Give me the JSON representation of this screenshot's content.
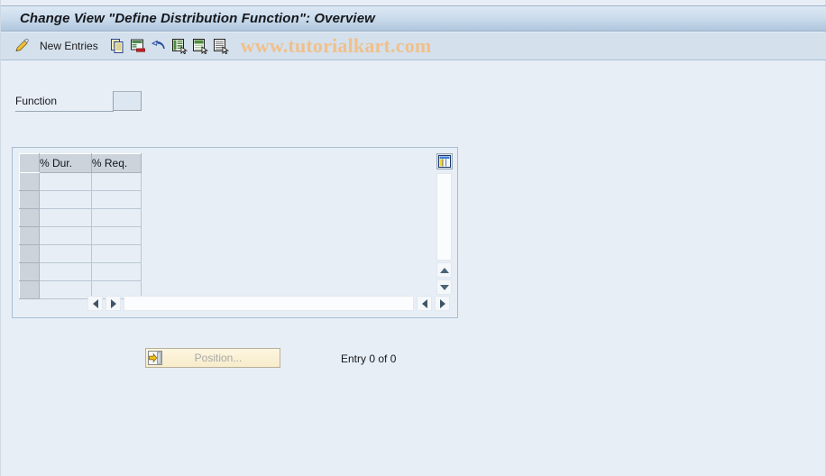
{
  "window": {
    "title": "Change View \"Define Distribution Function\": Overview"
  },
  "toolbar": {
    "display_change_icon": "pencil-display-change-icon",
    "new_entries_label": "New Entries",
    "buttons": [
      {
        "name": "copy-as-icon",
        "title": "Copy As..."
      },
      {
        "name": "delete-icon",
        "title": "Delete"
      },
      {
        "name": "undo-icon",
        "title": "Undo Change"
      },
      {
        "name": "select-all-icon",
        "title": "Select All"
      },
      {
        "name": "deselect-all-icon",
        "title": "Deselect All"
      },
      {
        "name": "select-block-icon",
        "title": "Select Block"
      }
    ],
    "watermark": "www.tutorialkart.com"
  },
  "form": {
    "function_label": "Function",
    "function_value": "",
    "function_placeholder": ""
  },
  "table": {
    "select_column_header": "",
    "columns": [
      "% Dur.",
      "% Req."
    ],
    "rows": [
      [
        "",
        ""
      ],
      [
        "",
        ""
      ],
      [
        "",
        ""
      ],
      [
        "",
        ""
      ],
      [
        "",
        ""
      ],
      [
        "",
        ""
      ],
      [
        "",
        ""
      ]
    ],
    "config_icon": "table-settings-icon"
  },
  "footer": {
    "position_button_label": "Position...",
    "position_button_icon": "position-goto-icon",
    "entry_count_text": "Entry 0 of 0"
  },
  "colors": {
    "page_background": "#e8eef5",
    "titlebar_top": "#dce8f4",
    "titlebar_bottom": "#afc6dd",
    "toolbar_background": "#d4e0ec",
    "watermark": "#f0c08a",
    "header_cell": "#ccd3da",
    "grid_line": "#b9c6d4",
    "button_yellow": "#f7ecca",
    "frame_border": "#a7bed4"
  }
}
